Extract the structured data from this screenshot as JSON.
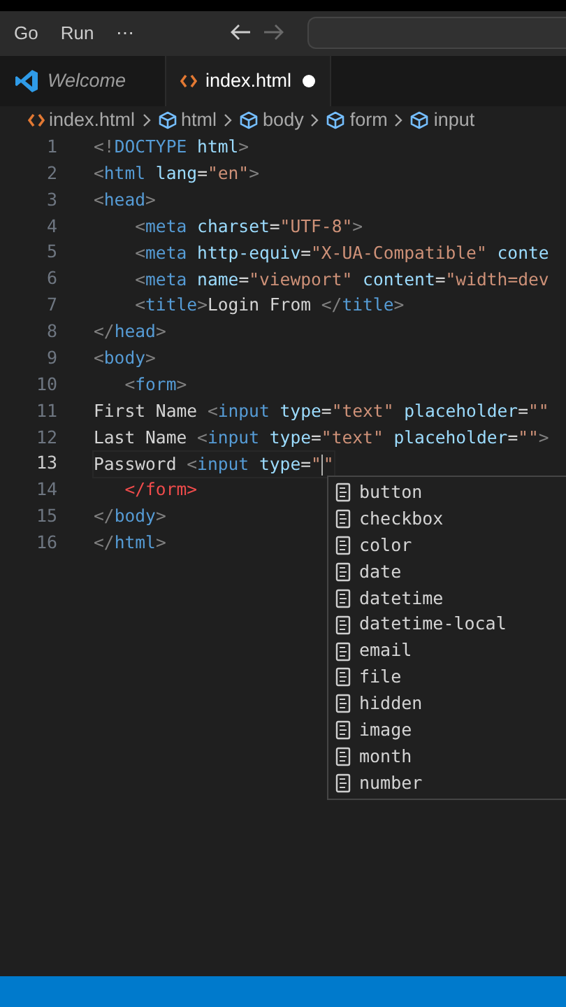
{
  "menu": [
    "Go",
    "Run",
    "⋯"
  ],
  "navigation": {
    "back_disabled": false,
    "forward_disabled": true
  },
  "tabs": [
    {
      "label": "Welcome",
      "kind": "welcome",
      "selected": false,
      "modified": false
    },
    {
      "label": "index.html",
      "kind": "html",
      "selected": true,
      "modified": true
    }
  ],
  "breadcrumb": [
    {
      "label": "index.html",
      "kind": "file"
    },
    {
      "label": "html",
      "kind": "element"
    },
    {
      "label": "body",
      "kind": "element"
    },
    {
      "label": "form",
      "kind": "element"
    },
    {
      "label": "input",
      "kind": "element"
    }
  ],
  "lines": [
    {
      "number": "1",
      "active": false,
      "tokens": [
        {
          "kind": "punct",
          "t": "<!"
        },
        {
          "kind": "tag",
          "t": "DOCTYPE"
        },
        {
          "kind": "attr",
          "t": " html"
        },
        {
          "kind": "punct",
          "t": ">"
        }
      ]
    },
    {
      "number": "2",
      "active": false,
      "tokens": [
        {
          "kind": "punct",
          "t": "<"
        },
        {
          "kind": "tag",
          "t": "html"
        },
        {
          "kind": "attr",
          "t": " lang"
        },
        {
          "kind": "text",
          "t": "="
        },
        {
          "kind": "string",
          "t": "\"en\""
        },
        {
          "kind": "punct",
          "t": ">"
        }
      ]
    },
    {
      "number": "3",
      "active": false,
      "tokens": [
        {
          "kind": "punct",
          "t": "<"
        },
        {
          "kind": "tag",
          "t": "head"
        },
        {
          "kind": "punct",
          "t": ">"
        }
      ]
    },
    {
      "number": "4",
      "active": false,
      "tokens": [
        {
          "kind": "punct",
          "t": "    <"
        },
        {
          "kind": "tag",
          "t": "meta"
        },
        {
          "kind": "attr",
          "t": " charset"
        },
        {
          "kind": "text",
          "t": "="
        },
        {
          "kind": "string",
          "t": "\"UTF-8\""
        },
        {
          "kind": "punct",
          "t": ">"
        }
      ]
    },
    {
      "number": "5",
      "active": false,
      "tokens": [
        {
          "kind": "punct",
          "t": "    <"
        },
        {
          "kind": "tag",
          "t": "meta"
        },
        {
          "kind": "attr",
          "t": " http-equiv"
        },
        {
          "kind": "text",
          "t": "="
        },
        {
          "kind": "string",
          "t": "\"X-UA-Compatible\""
        },
        {
          "kind": "attr",
          "t": " conte"
        }
      ]
    },
    {
      "number": "6",
      "active": false,
      "tokens": [
        {
          "kind": "punct",
          "t": "    <"
        },
        {
          "kind": "tag",
          "t": "meta"
        },
        {
          "kind": "attr",
          "t": " name"
        },
        {
          "kind": "text",
          "t": "="
        },
        {
          "kind": "string",
          "t": "\"viewport\""
        },
        {
          "kind": "attr",
          "t": " content"
        },
        {
          "kind": "text",
          "t": "="
        },
        {
          "kind": "string",
          "t": "\"width=dev"
        }
      ]
    },
    {
      "number": "7",
      "active": false,
      "tokens": [
        {
          "kind": "punct",
          "t": "    <"
        },
        {
          "kind": "tag",
          "t": "title"
        },
        {
          "kind": "punct",
          "t": ">"
        },
        {
          "kind": "text",
          "t": "Login From "
        },
        {
          "kind": "punct",
          "t": "</"
        },
        {
          "kind": "tag",
          "t": "title"
        },
        {
          "kind": "punct",
          "t": ">"
        }
      ]
    },
    {
      "number": "8",
      "active": false,
      "tokens": [
        {
          "kind": "punct",
          "t": "</"
        },
        {
          "kind": "tag",
          "t": "head"
        },
        {
          "kind": "punct",
          "t": ">"
        }
      ]
    },
    {
      "number": "9",
      "active": false,
      "tokens": [
        {
          "kind": "punct",
          "t": "<"
        },
        {
          "kind": "tag",
          "t": "body"
        },
        {
          "kind": "punct",
          "t": ">"
        }
      ]
    },
    {
      "number": "10",
      "active": false,
      "tokens": [
        {
          "kind": "punct",
          "t": "   <"
        },
        {
          "kind": "tag",
          "t": "form"
        },
        {
          "kind": "punct",
          "t": ">"
        }
      ]
    },
    {
      "number": "11",
      "active": false,
      "tokens": [
        {
          "kind": "text",
          "t": "First Name "
        },
        {
          "kind": "punct",
          "t": "<"
        },
        {
          "kind": "tag",
          "t": "input"
        },
        {
          "kind": "attr",
          "t": " type"
        },
        {
          "kind": "text",
          "t": "="
        },
        {
          "kind": "string",
          "t": "\"text\""
        },
        {
          "kind": "attr",
          "t": " placeholder"
        },
        {
          "kind": "text",
          "t": "="
        },
        {
          "kind": "string",
          "t": "\"\""
        }
      ]
    },
    {
      "number": "12",
      "active": false,
      "tokens": [
        {
          "kind": "text",
          "t": "Last Name "
        },
        {
          "kind": "punct",
          "t": "<"
        },
        {
          "kind": "tag",
          "t": "input"
        },
        {
          "kind": "attr",
          "t": " type"
        },
        {
          "kind": "text",
          "t": "="
        },
        {
          "kind": "string",
          "t": "\"text\""
        },
        {
          "kind": "attr",
          "t": " placeholder"
        },
        {
          "kind": "text",
          "t": "="
        },
        {
          "kind": "string",
          "t": "\"\""
        },
        {
          "kind": "punct",
          "t": ">"
        }
      ]
    },
    {
      "number": "13",
      "active": true,
      "tokens": [
        {
          "kind": "text",
          "t": "Password "
        },
        {
          "kind": "punct",
          "t": "<"
        },
        {
          "kind": "tag",
          "t": "input"
        },
        {
          "kind": "attr",
          "t": " type"
        },
        {
          "kind": "text",
          "t": "="
        },
        {
          "kind": "string",
          "t": "\""
        },
        {
          "kind": "cursor"
        },
        {
          "kind": "string",
          "t": "\""
        }
      ]
    },
    {
      "number": "14",
      "active": false,
      "tokens": [
        {
          "kind": "error",
          "t": "   </form>"
        }
      ]
    },
    {
      "number": "15",
      "active": false,
      "tokens": [
        {
          "kind": "punct",
          "t": "</"
        },
        {
          "kind": "tag",
          "t": "body"
        },
        {
          "kind": "punct",
          "t": ">"
        }
      ]
    },
    {
      "number": "16",
      "active": false,
      "tokens": [
        {
          "kind": "punct",
          "t": "</"
        },
        {
          "kind": "tag",
          "t": "html"
        },
        {
          "kind": "punct",
          "t": ">"
        }
      ]
    }
  ],
  "suggestions": [
    "button",
    "checkbox",
    "color",
    "date",
    "datetime",
    "datetime-local",
    "email",
    "file",
    "hidden",
    "image",
    "month",
    "number"
  ]
}
